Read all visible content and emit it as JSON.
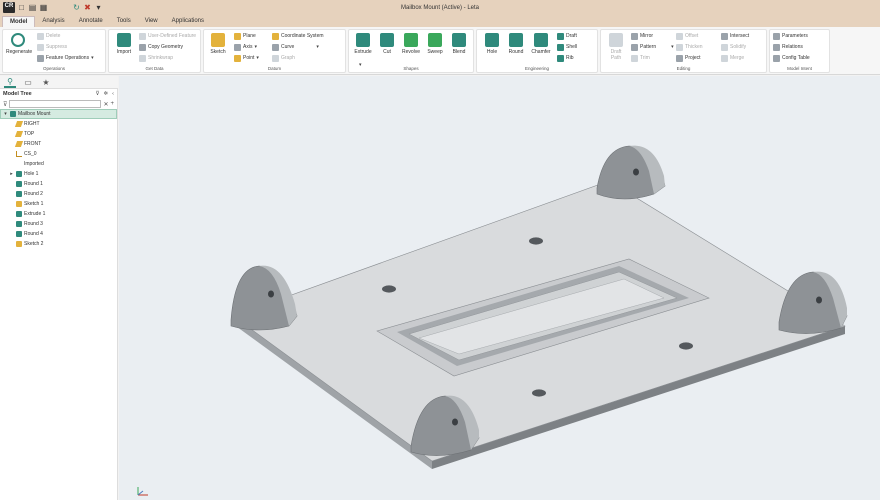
{
  "window": {
    "title": "Mailbox Mount (Active) - Leta",
    "logo_text": "CR"
  },
  "quick_access": {
    "icons": [
      "new-icon",
      "open-icon",
      "save-icon",
      "regenerate-icon",
      "close-icon",
      "more-icon"
    ],
    "glyphs": [
      "□",
      "▤",
      "▦",
      "↻",
      "✖",
      "▾"
    ]
  },
  "tabs": [
    {
      "label": "Model",
      "active": true
    },
    {
      "label": "Analysis"
    },
    {
      "label": "Annotate"
    },
    {
      "label": "Tools"
    },
    {
      "label": "View"
    },
    {
      "label": "Applications"
    }
  ],
  "ribbon": {
    "operations": {
      "name": "Operations",
      "regenerate": "Regenerate",
      "delete": "Delete",
      "suppress": "Suppress",
      "feature_operations": "Feature Operations"
    },
    "get_data": {
      "name": "Get Data",
      "import": "Import",
      "user_defined_feature": "User-Defined Feature",
      "copy_geometry": "Copy Geometry",
      "shrinkwrap": "Shrinkwrap"
    },
    "datum": {
      "name": "Datum",
      "sketch": "Sketch",
      "plane": "Plane",
      "axis": "Axis",
      "point": "Point",
      "coordinate_system": "Coordinate System",
      "curve": "Curve",
      "graph": "Graph"
    },
    "shapes": {
      "name": "Shapes",
      "extrude": "Extrude",
      "cut": "Cut",
      "revolve": "Revolve",
      "sweep": "Sweep",
      "blend": "Blend"
    },
    "engineering": {
      "name": "Engineering",
      "hole": "Hole",
      "round": "Round",
      "chamfer": "Chamfer",
      "draft": "Draft",
      "shell": "Shell",
      "rib": "Rib"
    },
    "editing": {
      "name": "Editing",
      "user_defined": "Draft",
      "user_defined2": "Path",
      "mirror": "Mirror",
      "pattern": "Pattern",
      "trim": "Trim",
      "offset": "Offset",
      "thicken": "Thicken",
      "project": "Project",
      "intersect": "Intersect",
      "solidify": "Solidify",
      "merge": "Merge"
    },
    "model_intent": {
      "name": "Model Intent",
      "parameters": "Parameters",
      "relations": "Relations",
      "config_table": "Config Table"
    }
  },
  "model_tree": {
    "title": "Model Tree",
    "items": [
      {
        "label": "Mailbox Mount",
        "icon": "part-icon",
        "selected": true,
        "expander": "▾"
      },
      {
        "label": "RIGHT",
        "icon": "datum-plane-icon"
      },
      {
        "label": "TOP",
        "icon": "datum-plane-icon"
      },
      {
        "label": "FRONT",
        "icon": "datum-plane-icon"
      },
      {
        "label": "CS_0",
        "icon": "coordinate-system-icon"
      },
      {
        "label": "Imported",
        "icon": "none"
      },
      {
        "label": "Hole 1",
        "icon": "hole-icon",
        "expander": "▸"
      },
      {
        "label": "Round 1",
        "icon": "round-icon"
      },
      {
        "label": "Round 2",
        "icon": "round-icon"
      },
      {
        "label": "Sketch 1",
        "icon": "sketch-icon"
      },
      {
        "label": "Extrude 1",
        "icon": "extrude-icon"
      },
      {
        "label": "Round 3",
        "icon": "round-icon"
      },
      {
        "label": "Round 4",
        "icon": "round-icon"
      },
      {
        "label": "Sketch 2",
        "icon": "sketch-icon"
      }
    ]
  },
  "colors": {
    "title_bar": "#e6d2bd",
    "accent": "#2f8a7c",
    "viewport": "#eaeef2",
    "part_top": "#d8dadc",
    "part_side": "#8e9296"
  }
}
